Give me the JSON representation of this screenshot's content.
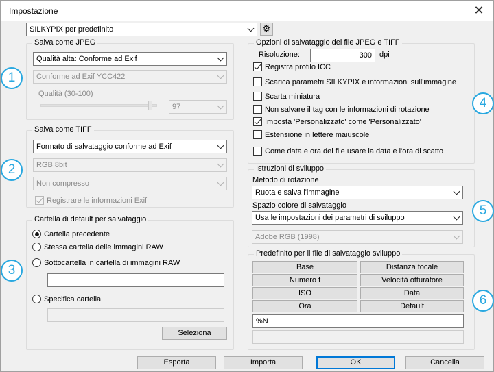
{
  "window": {
    "title": "Impostazione",
    "close": "✕"
  },
  "preset": {
    "value": "SILKYPIX per predefinito",
    "gear_icon": "⚙"
  },
  "jpeg": {
    "legend": "Salva come JPEG",
    "quality_select": "Qualità alta: Conforme ad Exif",
    "format_select": "Conforme ad Exif YCC422",
    "quality_label": "Qualità (30-100)",
    "quality_value": "97"
  },
  "tiff": {
    "legend": "Salva come TIFF",
    "format_select": "Formato di salvataggio conforme ad Exif",
    "bits_select": "RGB 8bit",
    "compression_select": "Non compresso",
    "exif_label": "Registrare le informazioni Exif"
  },
  "folder": {
    "legend": "Cartella di default per salvataggio",
    "options": [
      "Cartella precedente",
      "Stessa cartella delle immagini RAW",
      "Sottocartella in cartella di immagini RAW",
      "Specifica cartella"
    ],
    "subfolder_value": "",
    "specific_value": "",
    "select_button": "Seleziona"
  },
  "save_options": {
    "legend": "Opzioni di salvataggio dei file JPEG e TIFF",
    "resolution_label": "Risoluzione:",
    "resolution_value": "300",
    "resolution_unit": "dpi",
    "checks": [
      {
        "label": "Registra profilo ICC",
        "checked": true
      },
      {
        "label": "Scarica parametri SILKYPIX e informazioni sull'immagine",
        "checked": false
      },
      {
        "label": "Scarta miniatura",
        "checked": false
      },
      {
        "label": "Non salvare il tag con le informazioni di rotazione",
        "checked": false
      },
      {
        "label": "Imposta 'Personalizzato' come 'Personalizzato'",
        "checked": true
      },
      {
        "label": "Estensione in lettere maiuscole",
        "checked": false
      },
      {
        "label": "Come data e ora del file usare la data e l'ora di scatto",
        "checked": false
      }
    ]
  },
  "development": {
    "legend": "Istruzioni di sviluppo",
    "rotation_label": "Metodo di rotazione",
    "rotation_select": "Ruota e salva l'immagine",
    "colorspace_label": "Spazio colore di salvataggio",
    "colorspace_select": "Usa le impostazioni dei parametri di sviluppo",
    "adobe_select": "Adobe RGB (1998)"
  },
  "filename": {
    "legend": "Predefinito per il file di salvataggio sviluppo",
    "buttons": [
      "Base",
      "Distanza focale",
      "Numero f",
      "Velocità otturatore",
      "ISO",
      "Data",
      "Ora",
      "Default"
    ],
    "pattern_value": "%N",
    "preview_value": ""
  },
  "footer": {
    "export": "Esporta",
    "import": "Importa",
    "ok": "OK",
    "cancel": "Cancella"
  },
  "callouts": [
    "1",
    "2",
    "3",
    "4",
    "5",
    "6"
  ],
  "colors": {
    "callout": "#29a8e0",
    "default_button_border": "#0078d7"
  }
}
